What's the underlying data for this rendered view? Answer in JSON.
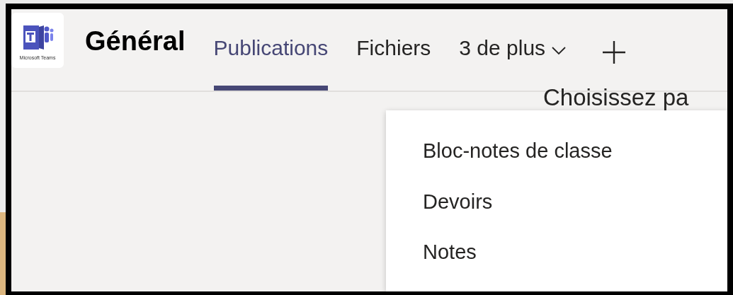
{
  "logo": {
    "caption": "Microsoft Teams"
  },
  "channel": {
    "title": "Général"
  },
  "tabs": [
    {
      "label": "Publications",
      "selected": true,
      "kind": "tab"
    },
    {
      "label": "Fichiers",
      "selected": false,
      "kind": "tab"
    },
    {
      "label": "3 de plus",
      "selected": false,
      "kind": "more"
    }
  ],
  "content": {
    "heading": "Choisissez pa"
  },
  "menu": {
    "items": [
      "Bloc-notes de classe",
      "Devoirs",
      "Notes"
    ]
  }
}
